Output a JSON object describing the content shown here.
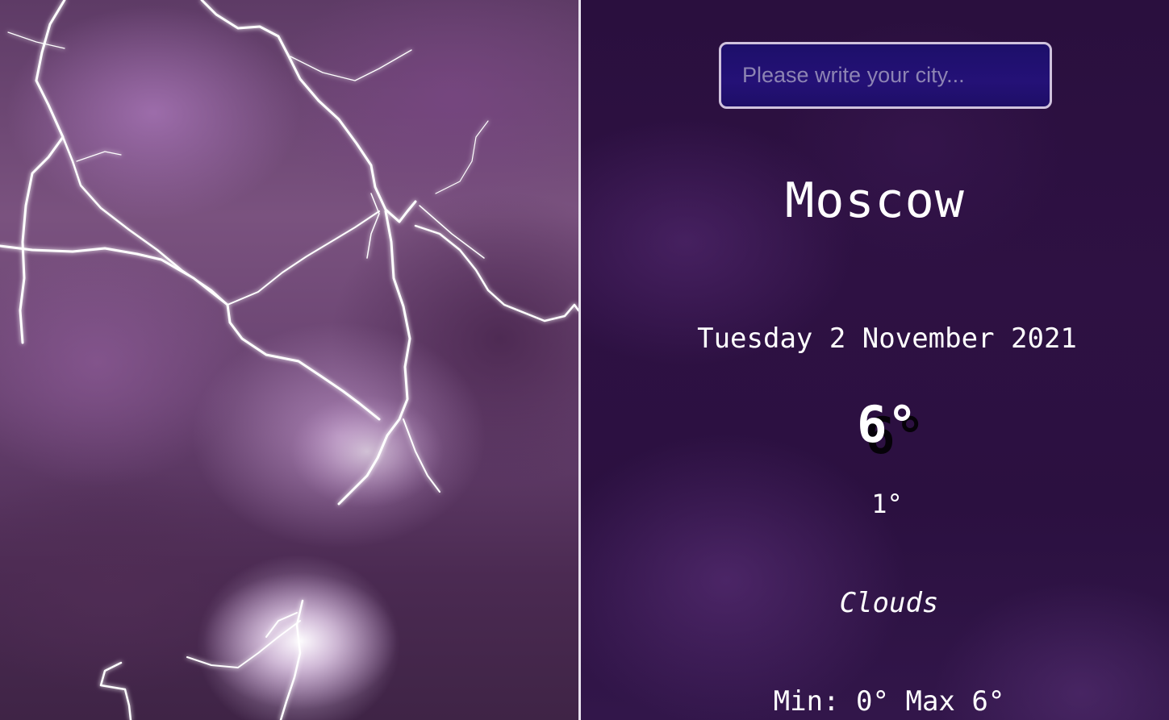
{
  "search": {
    "placeholder": "Please write your city...",
    "value": ""
  },
  "weather": {
    "city": "Moscow",
    "date": "Tuesday 2 November 2021",
    "temperature": "6°",
    "feels_like": "1°",
    "condition": "Clouds",
    "min_label": "Min:",
    "min_value": "0°",
    "max_label": "Max",
    "max_value": "6°"
  },
  "colors": {
    "panel_background": "#2a0f3e",
    "search_background": "#1d0f6a",
    "search_border": "#cfc2dd",
    "text": "#ffffff",
    "divider": "#e8e2ee"
  },
  "icons": {
    "background_art": "lightning-storm-image"
  }
}
